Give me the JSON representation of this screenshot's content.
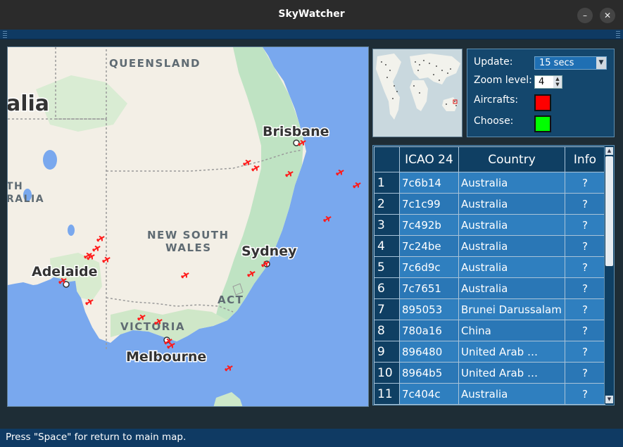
{
  "window": {
    "title": "SkyWatcher",
    "minimize_glyph": "–",
    "close_glyph": "✕"
  },
  "map": {
    "labels": {
      "queensland": "QUEENSLAND",
      "australia_partial": "alia",
      "south_australia_1": "TH",
      "south_australia_2": "RALIA",
      "nsw_1": "NEW SOUTH",
      "nsw_2": "WALES",
      "act": "ACT",
      "victoria": "VICTORIA",
      "brisbane": "Brisbane",
      "sydney": "Sydney",
      "adelaide": "Adelaide",
      "melbourne": "Melbourne"
    },
    "colors": {
      "ocean": "#79a8ee",
      "land": "#f3efe6",
      "vegetation": "#bfe3c3",
      "aircraft": "#ff1a1a"
    },
    "icon": "aircraft-icon"
  },
  "settings": {
    "update_label": "Update:",
    "update_value": "15 secs",
    "zoom_label": "Zoom level:",
    "zoom_value": "4",
    "aircrafts_label": "Aircrafts:",
    "aircrafts_color": "#ff0000",
    "choose_label": "Choose:",
    "choose_color": "#00ff00"
  },
  "table": {
    "headers": [
      "ICAO 24",
      "Country",
      "Info"
    ],
    "rows": [
      {
        "idx": "1",
        "icao": "7c6b14",
        "country": "Australia",
        "info": "?"
      },
      {
        "idx": "2",
        "icao": "7c1c99",
        "country": "Australia",
        "info": "?"
      },
      {
        "idx": "3",
        "icao": "7c492b",
        "country": "Australia",
        "info": "?"
      },
      {
        "idx": "4",
        "icao": "7c24be",
        "country": "Australia",
        "info": "?"
      },
      {
        "idx": "5",
        "icao": "7c6d9c",
        "country": "Australia",
        "info": "?"
      },
      {
        "idx": "6",
        "icao": "7c7651",
        "country": "Australia",
        "info": "?"
      },
      {
        "idx": "7",
        "icao": "895053",
        "country": "Brunei Darussalam",
        "info": "?"
      },
      {
        "idx": "8",
        "icao": "780a16",
        "country": "China",
        "info": "?"
      },
      {
        "idx": "9",
        "icao": "896480",
        "country": "United Arab …",
        "info": "?"
      },
      {
        "idx": "10",
        "icao": "8964b5",
        "country": "United Arab …",
        "info": "?"
      },
      {
        "idx": "11",
        "icao": "7c404c",
        "country": "Australia",
        "info": "?"
      }
    ]
  },
  "status": {
    "text": "Press \"Space\" for return to main map."
  }
}
